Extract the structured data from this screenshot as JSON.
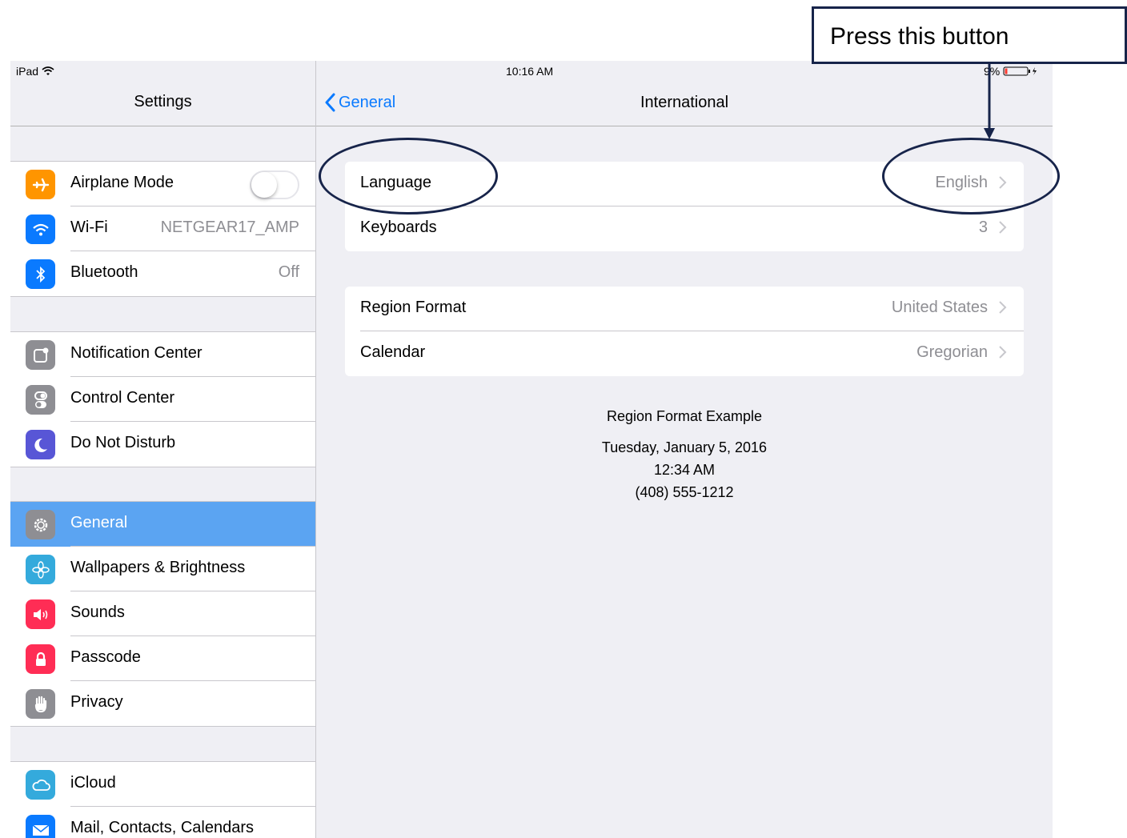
{
  "status_bar": {
    "device": "iPad",
    "time": "10:16 AM",
    "battery": "9%"
  },
  "sidebar": {
    "title": "Settings",
    "groups": [
      {
        "items": [
          {
            "label": "Airplane Mode",
            "icon": "airplane-icon",
            "color": "#ff9500",
            "toggle": false
          },
          {
            "label": "Wi-Fi",
            "value": "NETGEAR17_AMP",
            "icon": "wifi-icon",
            "color": "#0a7aff"
          },
          {
            "label": "Bluetooth",
            "value": "Off",
            "icon": "bluetooth-icon",
            "color": "#0a7aff"
          }
        ]
      },
      {
        "items": [
          {
            "label": "Notification Center",
            "icon": "notification-icon",
            "color": "#8e8e93"
          },
          {
            "label": "Control Center",
            "icon": "control-center-icon",
            "color": "#8e8e93"
          },
          {
            "label": "Do Not Disturb",
            "icon": "moon-icon",
            "color": "#5856d6"
          }
        ]
      },
      {
        "items": [
          {
            "label": "General",
            "icon": "gear-icon",
            "color": "#8e8e93",
            "selected": true
          },
          {
            "label": "Wallpapers & Brightness",
            "icon": "flower-icon",
            "color": "#34aadc"
          },
          {
            "label": "Sounds",
            "icon": "speaker-icon",
            "color": "#ff2d55"
          },
          {
            "label": "Passcode",
            "icon": "lock-icon",
            "color": "#ff2d55"
          },
          {
            "label": "Privacy",
            "icon": "hand-icon",
            "color": "#8e8e93"
          }
        ]
      },
      {
        "items": [
          {
            "label": "iCloud",
            "icon": "cloud-icon",
            "color": "#34aadc"
          },
          {
            "label": "Mail, Contacts, Calendars",
            "icon": "mail-icon",
            "color": "#0a7aff"
          }
        ]
      }
    ]
  },
  "detail": {
    "back_label": "General",
    "title": "International",
    "groups": [
      {
        "rows": [
          {
            "label": "Language",
            "value": "English"
          },
          {
            "label": "Keyboards",
            "value": "3"
          }
        ]
      },
      {
        "rows": [
          {
            "label": "Region Format",
            "value": "United States"
          },
          {
            "label": "Calendar",
            "value": "Gregorian"
          }
        ]
      }
    ],
    "example": {
      "heading": "Region Format Example",
      "date": "Tuesday, January 5, 2016",
      "time": "12:34 AM",
      "phone": "(408) 555-1212"
    }
  },
  "annotation": {
    "callout_text": "Press this button",
    "color": "#17244a"
  }
}
